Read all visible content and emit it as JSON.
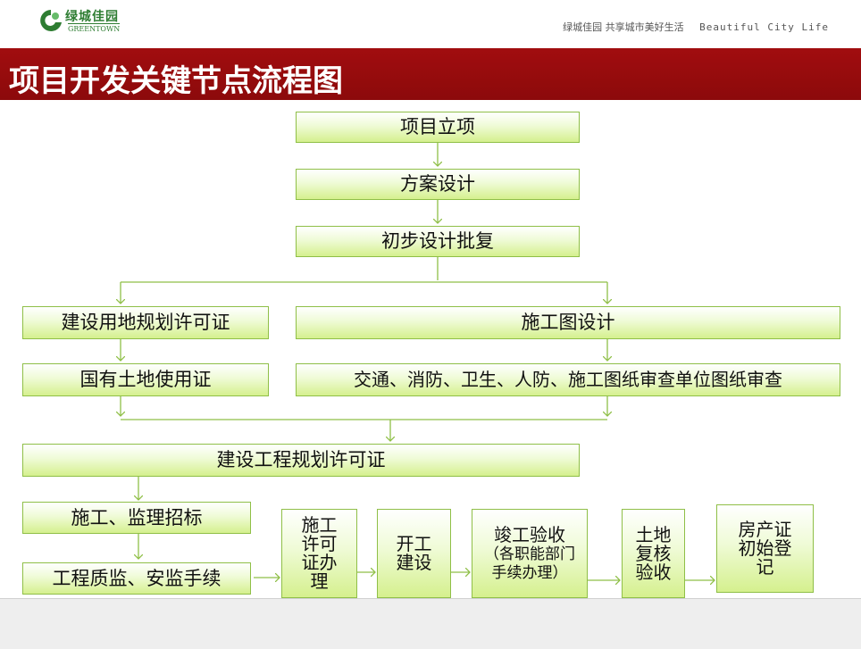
{
  "header": {
    "logo_text": "绿城佳园",
    "logo_subtext": "GREENTOWN",
    "tagline_cn": "绿城佳园  共享城市美好生活",
    "tagline_en": "Beautiful City Life",
    "title_bar_color": "#a10d0f"
  },
  "slide": {
    "title": "项目开发关键节点流程图"
  },
  "nodes": {
    "project_approval": "项目立项",
    "scheme_design": "方案设计",
    "preliminary_design_approval": "初步设计批复",
    "land_planning_permit": "建设用地规划许可证",
    "construction_drawing_design": "施工图设计",
    "land_use_certificate": "国有土地使用证",
    "drawing_review": "交通、消防、卫生、人防、施工图纸审查单位图纸审查",
    "engineering_planning_permit": "建设工程规划许可证",
    "construction_supervision_tender": "施工、监理招标",
    "quality_safety_procedures": "工程质监、安监手续",
    "construction_permit": "施工许可证办理",
    "construction_start": "开工建设",
    "completion_acceptance": "竣工验收",
    "completion_acceptance_note": "（各职能部门手续办理）",
    "land_review": "土地复核验收",
    "property_certificate": "房产证初始登记"
  },
  "colors": {
    "box_border": "#8fbf47",
    "box_fill_top": "#ffffff",
    "box_fill_bottom": "#d5f08e",
    "connector": "#8fbf47"
  }
}
